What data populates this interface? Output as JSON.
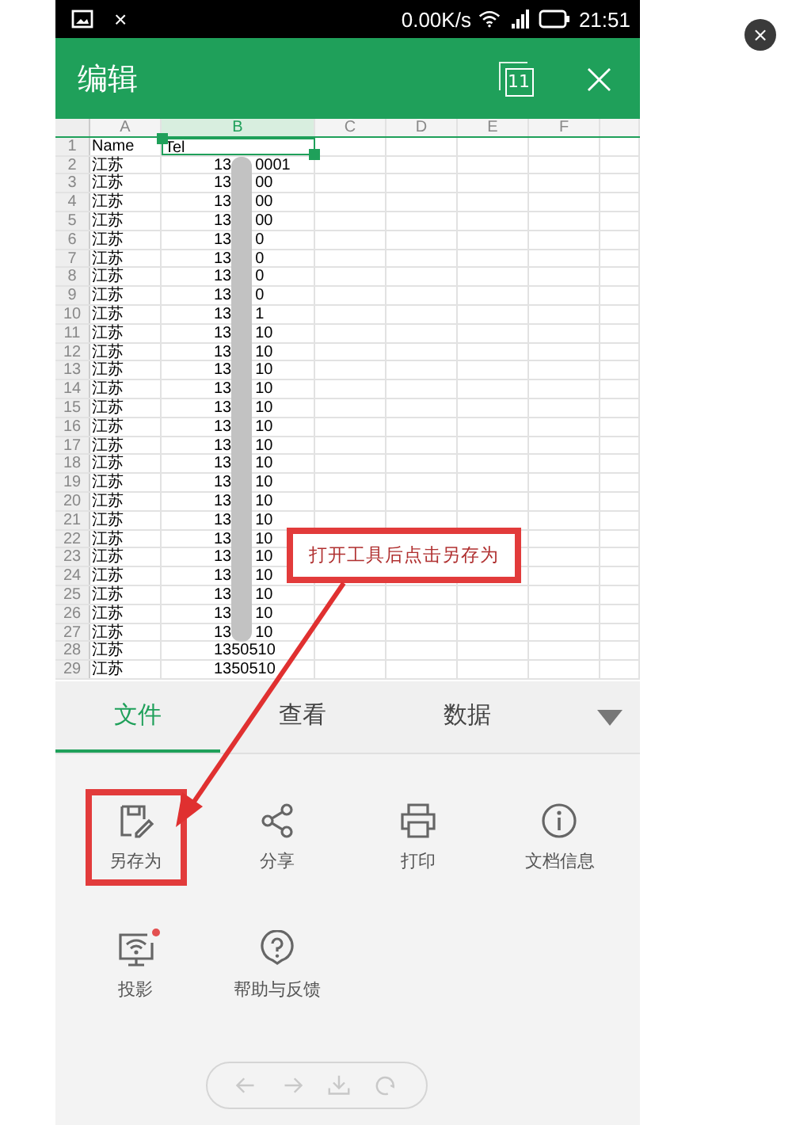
{
  "status_bar": {
    "close_label": "×",
    "speed": "0.00K/s",
    "time": "21:51"
  },
  "header": {
    "title": "编辑",
    "sheet_count": "11",
    "close_label": "×"
  },
  "sheet": {
    "columns": [
      "A",
      "B",
      "C",
      "D",
      "E",
      "F"
    ],
    "header_row": {
      "num": "1",
      "a": "Name",
      "b": "Tel"
    },
    "rows": [
      {
        "num": "2",
        "a": "江苏",
        "b": "13",
        "b_tail": "0001"
      },
      {
        "num": "3",
        "a": "江苏",
        "b": "13",
        "b_tail": "00"
      },
      {
        "num": "4",
        "a": "江苏",
        "b": "13",
        "b_tail": "00"
      },
      {
        "num": "5",
        "a": "江苏",
        "b": "13",
        "b_tail": "00"
      },
      {
        "num": "6",
        "a": "江苏",
        "b": "13",
        "b_tail": "0"
      },
      {
        "num": "7",
        "a": "江苏",
        "b": "13",
        "b_tail": "0"
      },
      {
        "num": "8",
        "a": "江苏",
        "b": "13",
        "b_tail": "0"
      },
      {
        "num": "9",
        "a": "江苏",
        "b": "13",
        "b_tail": "0"
      },
      {
        "num": "10",
        "a": "江苏",
        "b": "13",
        "b_tail": "1"
      },
      {
        "num": "11",
        "a": "江苏",
        "b": "13",
        "b_tail": "10"
      },
      {
        "num": "12",
        "a": "江苏",
        "b": "13",
        "b_tail": "10"
      },
      {
        "num": "13",
        "a": "江苏",
        "b": "13",
        "b_tail": "10"
      },
      {
        "num": "14",
        "a": "江苏",
        "b": "13",
        "b_tail": "10"
      },
      {
        "num": "15",
        "a": "江苏",
        "b": "13",
        "b_tail": "10"
      },
      {
        "num": "16",
        "a": "江苏",
        "b": "13",
        "b_tail": "10"
      },
      {
        "num": "17",
        "a": "江苏",
        "b": "13",
        "b_tail": "10"
      },
      {
        "num": "18",
        "a": "江苏",
        "b": "13",
        "b_tail": "10"
      },
      {
        "num": "19",
        "a": "江苏",
        "b": "13",
        "b_tail": "10"
      },
      {
        "num": "20",
        "a": "江苏",
        "b": "13",
        "b_tail": "10"
      },
      {
        "num": "21",
        "a": "江苏",
        "b": "13",
        "b_tail": "10"
      },
      {
        "num": "22",
        "a": "江苏",
        "b": "13",
        "b_tail": "10"
      },
      {
        "num": "23",
        "a": "江苏",
        "b": "13",
        "b_tail": "10"
      },
      {
        "num": "24",
        "a": "江苏",
        "b": "13",
        "b_tail": "10"
      },
      {
        "num": "25",
        "a": "江苏",
        "b": "13",
        "b_tail": "10"
      },
      {
        "num": "26",
        "a": "江苏",
        "b": "13",
        "b_tail": "10"
      },
      {
        "num": "27",
        "a": "江苏",
        "b": "13",
        "b_tail": "10"
      },
      {
        "num": "28",
        "a": "江苏",
        "b": "1350510"
      },
      {
        "num": "29",
        "a": "江苏",
        "b": "1350510"
      }
    ]
  },
  "tabs": [
    {
      "label": "文件",
      "selected": true
    },
    {
      "label": "查看",
      "selected": false
    },
    {
      "label": "数据",
      "selected": false
    }
  ],
  "tools": [
    {
      "kind": "save",
      "label": "另存为",
      "highlighted": true,
      "dot": false
    },
    {
      "kind": "share",
      "label": "分享",
      "highlighted": false,
      "dot": false
    },
    {
      "kind": "print",
      "label": "打印",
      "highlighted": false,
      "dot": false
    },
    {
      "kind": "info",
      "label": "文档信息",
      "highlighted": false,
      "dot": false
    },
    {
      "kind": "cast",
      "label": "投影",
      "highlighted": false,
      "dot": true
    },
    {
      "kind": "help",
      "label": "帮助与反馈",
      "highlighted": false,
      "dot": false
    }
  ],
  "annotation": {
    "callout": "打开工具后点击另存为"
  }
}
